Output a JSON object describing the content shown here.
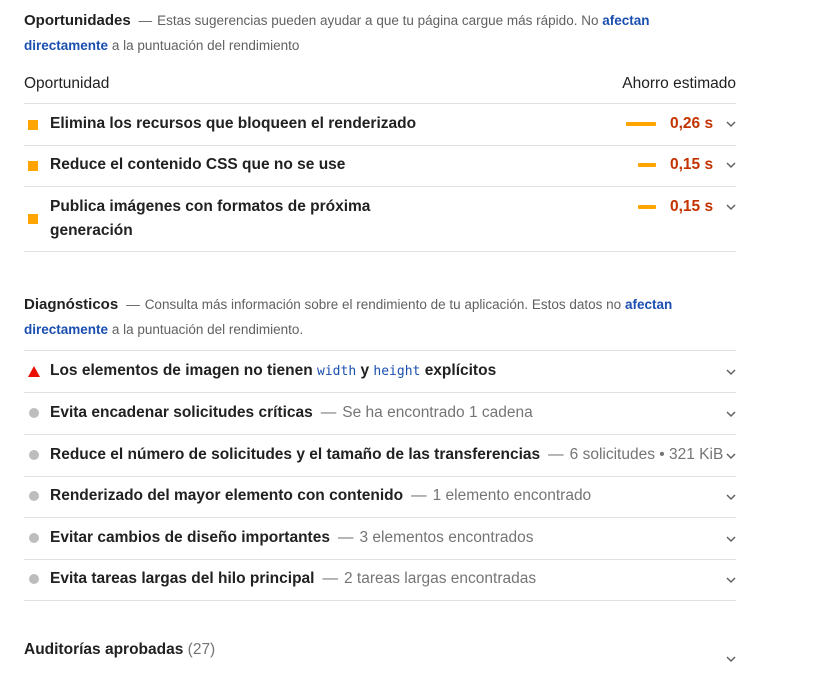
{
  "opportunities": {
    "title": "Oportunidades",
    "desc_pre": "Estas sugerencias pueden ayudar a que tu página cargue más rápido. No",
    "link1": "afectan",
    "link2": "directamente",
    "desc_post": "a la puntuación del rendimiento",
    "col_left": "Oportunidad",
    "col_right": "Ahorro estimado",
    "items": [
      {
        "label": "Elimina los recursos que bloqueen el renderizado",
        "saving": "0,26 s",
        "fraction": 0.26
      },
      {
        "label": "Reduce el contenido CSS que no se use",
        "saving": "0,15 s",
        "fraction": 0.15
      },
      {
        "label_line1": "Publica imágenes con formatos de próxima",
        "label_line2": "generación",
        "saving": "0,15 s",
        "fraction": 0.15
      }
    ]
  },
  "diagnostics": {
    "title": "Diagnósticos",
    "desc_pre": "Consulta más información sobre el rendimiento de tu aplicación. Estos datos no",
    "link1": "afectan",
    "link2": "directamente",
    "desc_post": "a la puntuación del rendimiento.",
    "items": [
      {
        "pre": "Los elementos de imagen no tienen",
        "code1": "width",
        "mid": "y",
        "code2": "height",
        "post": "explícitos",
        "status": "fail",
        "icon": "warning-triangle-icon"
      },
      {
        "label": "Evita encadenar solicitudes críticas",
        "detail": "Se ha encontrado 1 cadena",
        "status": "info",
        "icon": "gray-dot-icon"
      },
      {
        "label": "Reduce el número de solicitudes y el tamaño de las transferencias",
        "detail": "6 solicitudes • 321 KiB",
        "status": "info",
        "icon": "gray-dot-icon"
      },
      {
        "label": "Renderizado del mayor elemento con contenido",
        "detail": "1 elemento encontrado",
        "status": "info",
        "icon": "gray-dot-icon"
      },
      {
        "label": "Evitar cambios de diseño importantes",
        "detail": "3 elementos encontrados",
        "status": "info",
        "icon": "gray-dot-icon"
      },
      {
        "label": "Evita tareas largas del hilo principal",
        "detail": "2 tareas largas encontradas",
        "status": "info",
        "icon": "gray-dot-icon"
      }
    ]
  },
  "passed": {
    "title": "Auditorías aprobadas",
    "count": "(27)"
  },
  "colors": {
    "accent_orange": "#ffa400",
    "saving_text": "#c33300",
    "fail_red": "#eb0f00",
    "info_gray": "#bdbdbd",
    "link_blue": "#1a4fb0"
  }
}
